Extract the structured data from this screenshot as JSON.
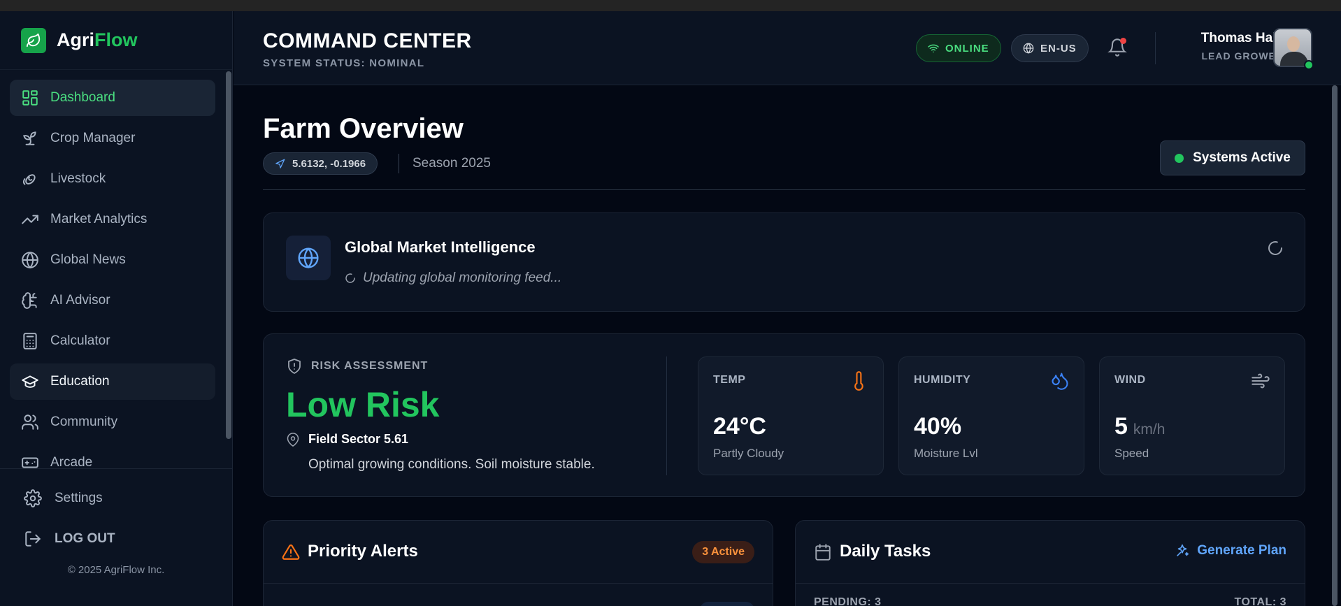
{
  "brand": {
    "name_part1": "Agri",
    "name_part2": "Flow"
  },
  "sidebar": {
    "items": [
      {
        "label": "Dashboard",
        "icon": "dashboard-grid-icon"
      },
      {
        "label": "Crop Manager",
        "icon": "sprout-icon"
      },
      {
        "label": "Livestock",
        "icon": "livestock-icon"
      },
      {
        "label": "Market Analytics",
        "icon": "trending-up-icon"
      },
      {
        "label": "Global News",
        "icon": "globe-icon"
      },
      {
        "label": "AI Advisor",
        "icon": "brain-icon"
      },
      {
        "label": "Calculator",
        "icon": "calculator-icon"
      },
      {
        "label": "Education",
        "icon": "graduation-cap-icon"
      },
      {
        "label": "Community",
        "icon": "users-icon"
      },
      {
        "label": "Arcade",
        "icon": "gamepad-icon"
      }
    ],
    "settings_label": "Settings",
    "logout_label": "LOG OUT",
    "copyright": "© 2025 AgriFlow Inc."
  },
  "header": {
    "title": "COMMAND CENTER",
    "subtitle": "SYSTEM STATUS: NOMINAL",
    "online_label": "ONLINE",
    "language_label": "EN-US",
    "user_name": "Thomas Hale",
    "user_role": "LEAD GROWER"
  },
  "overview": {
    "title": "Farm Overview",
    "coordinates": "5.6132, -0.1966",
    "season": "Season 2025",
    "systems_status": "Systems Active"
  },
  "market": {
    "title": "Global Market Intelligence",
    "status": "Updating global monitoring feed..."
  },
  "risk": {
    "label": "RISK ASSESSMENT",
    "level": "Low Risk",
    "field": "Field Sector 5.61",
    "description": "Optimal growing conditions. Soil moisture stable."
  },
  "metrics": {
    "temp": {
      "label": "TEMP",
      "value": "24°C",
      "desc": "Partly Cloudy"
    },
    "humidity": {
      "label": "HUMIDITY",
      "value": "40%",
      "desc": "Moisture Lvl"
    },
    "wind": {
      "label": "WIND",
      "value": "5",
      "unit": "km/h",
      "desc": "Speed"
    }
  },
  "alerts": {
    "title": "Priority Alerts",
    "badge": "3 Active"
  },
  "tasks": {
    "title": "Daily Tasks",
    "generate_label": "Generate Plan",
    "pending": "PENDING: 3",
    "total": "TOTAL: 3"
  },
  "colors": {
    "accent": "#22c55e",
    "brand_green": "#16a34a",
    "link_blue": "#60a5fa",
    "alert_orange": "#fb923c"
  }
}
